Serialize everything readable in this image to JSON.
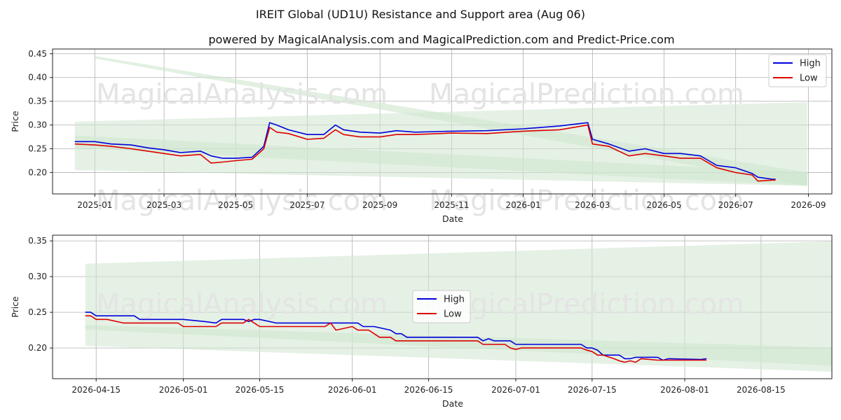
{
  "figure": {
    "title": "IREIT Global (UD1U) Resistance and Support area (Aug 06)",
    "subtitle": "powered by MagicalAnalysis.com and MagicalPrediction.com and Predict-Price.com",
    "watermarks": [
      "MagicalAnalysis.com",
      "MagicalPrediction.com"
    ]
  },
  "colors": {
    "high": "#0000dd",
    "low": "#dd0000",
    "band": "#cfe6cf",
    "grid": "#b0b0b0"
  },
  "chart_data": [
    {
      "type": "line",
      "xlabel": "Date",
      "ylabel": "Price",
      "xlim": [
        "2024-11-26",
        "2026-09-21"
      ],
      "ylim": [
        0.155,
        0.46
      ],
      "x_ticks": [
        "2025-01",
        "2025-03",
        "2025-05",
        "2025-07",
        "2025-09",
        "2025-11",
        "2026-01",
        "2026-03",
        "2026-05",
        "2026-07",
        "2026-09"
      ],
      "y_ticks": [
        "0.20",
        "0.25",
        "0.30",
        "0.35",
        "0.40",
        "0.45"
      ],
      "grid": true,
      "legend": "top-right",
      "series": [
        {
          "name": "High",
          "points": [
            [
              "2024-12-15",
              0.265
            ],
            [
              "2025-01-01",
              0.265
            ],
            [
              "2025-01-15",
              0.26
            ],
            [
              "2025-02-01",
              0.258
            ],
            [
              "2025-02-15",
              0.252
            ],
            [
              "2025-03-01",
              0.248
            ],
            [
              "2025-03-15",
              0.242
            ],
            [
              "2025-04-01",
              0.245
            ],
            [
              "2025-04-10",
              0.235
            ],
            [
              "2025-04-20",
              0.23
            ],
            [
              "2025-05-01",
              0.23
            ],
            [
              "2025-05-15",
              0.232
            ],
            [
              "2025-05-25",
              0.255
            ],
            [
              "2025-05-30",
              0.305
            ],
            [
              "2025-06-05",
              0.3
            ],
            [
              "2025-06-15",
              0.29
            ],
            [
              "2025-07-01",
              0.28
            ],
            [
              "2025-07-15",
              0.28
            ],
            [
              "2025-07-25",
              0.3
            ],
            [
              "2025-08-01",
              0.29
            ],
            [
              "2025-08-15",
              0.285
            ],
            [
              "2025-09-01",
              0.283
            ],
            [
              "2025-09-15",
              0.288
            ],
            [
              "2025-10-01",
              0.285
            ],
            [
              "2025-11-01",
              0.287
            ],
            [
              "2025-12-01",
              0.288
            ],
            [
              "2026-01-01",
              0.292
            ],
            [
              "2026-02-01",
              0.298
            ],
            [
              "2026-02-25",
              0.305
            ],
            [
              "2026-03-01",
              0.27
            ],
            [
              "2026-03-15",
              0.26
            ],
            [
              "2026-04-01",
              0.245
            ],
            [
              "2026-04-15",
              0.25
            ],
            [
              "2026-05-01",
              0.24
            ],
            [
              "2026-05-15",
              0.24
            ],
            [
              "2026-06-01",
              0.235
            ],
            [
              "2026-06-15",
              0.215
            ],
            [
              "2026-07-01",
              0.21
            ],
            [
              "2026-07-15",
              0.198
            ],
            [
              "2026-07-20",
              0.19
            ],
            [
              "2026-08-01",
              0.186
            ],
            [
              "2026-08-04",
              0.186
            ]
          ]
        },
        {
          "name": "Low",
          "points": [
            [
              "2024-12-15",
              0.26
            ],
            [
              "2025-01-01",
              0.258
            ],
            [
              "2025-01-15",
              0.255
            ],
            [
              "2025-02-01",
              0.25
            ],
            [
              "2025-02-15",
              0.245
            ],
            [
              "2025-03-01",
              0.24
            ],
            [
              "2025-03-15",
              0.235
            ],
            [
              "2025-04-01",
              0.238
            ],
            [
              "2025-04-10",
              0.22
            ],
            [
              "2025-04-20",
              0.222
            ],
            [
              "2025-05-01",
              0.225
            ],
            [
              "2025-05-15",
              0.228
            ],
            [
              "2025-05-25",
              0.25
            ],
            [
              "2025-05-30",
              0.295
            ],
            [
              "2025-06-05",
              0.285
            ],
            [
              "2025-06-15",
              0.282
            ],
            [
              "2025-07-01",
              0.27
            ],
            [
              "2025-07-15",
              0.272
            ],
            [
              "2025-07-25",
              0.29
            ],
            [
              "2025-08-01",
              0.28
            ],
            [
              "2025-08-15",
              0.275
            ],
            [
              "2025-09-01",
              0.275
            ],
            [
              "2025-09-15",
              0.28
            ],
            [
              "2025-10-01",
              0.28
            ],
            [
              "2025-11-01",
              0.283
            ],
            [
              "2025-12-01",
              0.282
            ],
            [
              "2026-01-01",
              0.287
            ],
            [
              "2026-02-01",
              0.29
            ],
            [
              "2026-02-25",
              0.3
            ],
            [
              "2026-03-01",
              0.26
            ],
            [
              "2026-03-15",
              0.255
            ],
            [
              "2026-04-01",
              0.235
            ],
            [
              "2026-04-15",
              0.24
            ],
            [
              "2026-05-01",
              0.235
            ],
            [
              "2026-05-15",
              0.23
            ],
            [
              "2026-06-01",
              0.23
            ],
            [
              "2026-06-15",
              0.21
            ],
            [
              "2026-07-01",
              0.2
            ],
            [
              "2026-07-15",
              0.195
            ],
            [
              "2026-07-20",
              0.182
            ],
            [
              "2026-08-01",
              0.184
            ],
            [
              "2026-08-04",
              0.184
            ]
          ]
        }
      ],
      "bands": [
        {
          "x": [
            "2024-12-15",
            "2026-08-31"
          ],
          "upper": [
            0.307,
            0.348
          ],
          "lower": [
            0.205,
            0.172
          ]
        },
        {
          "x": [
            "2024-12-15",
            "2026-08-31"
          ],
          "upper": [
            0.278,
            0.2
          ],
          "lower": [
            0.252,
            0.172
          ]
        },
        {
          "x": [
            "2025-01-01",
            "2026-08-31"
          ],
          "upper": [
            0.445,
            0.2
          ],
          "lower": [
            0.44,
            0.172
          ]
        }
      ]
    },
    {
      "type": "line",
      "xlabel": "Date",
      "ylabel": "Price",
      "xlim": [
        "2026-04-07",
        "2026-08-28"
      ],
      "ylim": [
        0.157,
        0.358
      ],
      "x_ticks": [
        "2026-04-15",
        "2026-05-01",
        "2026-05-15",
        "2026-06-01",
        "2026-06-15",
        "2026-07-01",
        "2026-07-15",
        "2026-08-01",
        "2026-08-15"
      ],
      "y_ticks": [
        "0.20",
        "0.25",
        "0.30",
        "0.35"
      ],
      "grid": true,
      "legend": "center",
      "series": [
        {
          "name": "High",
          "points": [
            [
              "2026-04-13",
              0.25
            ],
            [
              "2026-04-14",
              0.25
            ],
            [
              "2026-04-15",
              0.245
            ],
            [
              "2026-04-22",
              0.245
            ],
            [
              "2026-04-23",
              0.24
            ],
            [
              "2026-05-01",
              0.24
            ],
            [
              "2026-05-05",
              0.237
            ],
            [
              "2026-05-07",
              0.235
            ],
            [
              "2026-05-08",
              0.24
            ],
            [
              "2026-05-12",
              0.24
            ],
            [
              "2026-05-13",
              0.237
            ],
            [
              "2026-05-14",
              0.24
            ],
            [
              "2026-05-15",
              0.24
            ],
            [
              "2026-05-18",
              0.235
            ],
            [
              "2026-05-25",
              0.235
            ],
            [
              "2026-06-02",
              0.235
            ],
            [
              "2026-06-03",
              0.23
            ],
            [
              "2026-06-05",
              0.23
            ],
            [
              "2026-06-08",
              0.225
            ],
            [
              "2026-06-09",
              0.22
            ],
            [
              "2026-06-10",
              0.22
            ],
            [
              "2026-06-11",
              0.215
            ],
            [
              "2026-06-24",
              0.215
            ],
            [
              "2026-06-25",
              0.21
            ],
            [
              "2026-06-26",
              0.213
            ],
            [
              "2026-06-27",
              0.21
            ],
            [
              "2026-06-30",
              0.21
            ],
            [
              "2026-07-01",
              0.205
            ],
            [
              "2026-07-13",
              0.205
            ],
            [
              "2026-07-14",
              0.2
            ],
            [
              "2026-07-15",
              0.2
            ],
            [
              "2026-07-16",
              0.197
            ],
            [
              "2026-07-17",
              0.19
            ],
            [
              "2026-07-20",
              0.19
            ],
            [
              "2026-07-21",
              0.185
            ],
            [
              "2026-07-22",
              0.185
            ],
            [
              "2026-07-23",
              0.187
            ],
            [
              "2026-07-27",
              0.187
            ],
            [
              "2026-07-28",
              0.183
            ],
            [
              "2026-07-29",
              0.185
            ],
            [
              "2026-08-04",
              0.184
            ],
            [
              "2026-08-05",
              0.185
            ]
          ]
        },
        {
          "name": "Low",
          "points": [
            [
              "2026-04-13",
              0.245
            ],
            [
              "2026-04-14",
              0.245
            ],
            [
              "2026-04-15",
              0.24
            ],
            [
              "2026-04-17",
              0.24
            ],
            [
              "2026-04-20",
              0.235
            ],
            [
              "2026-04-30",
              0.235
            ],
            [
              "2026-05-01",
              0.23
            ],
            [
              "2026-05-07",
              0.23
            ],
            [
              "2026-05-08",
              0.235
            ],
            [
              "2026-05-12",
              0.235
            ],
            [
              "2026-05-13",
              0.24
            ],
            [
              "2026-05-14",
              0.235
            ],
            [
              "2026-05-15",
              0.23
            ],
            [
              "2026-05-27",
              0.23
            ],
            [
              "2026-05-28",
              0.235
            ],
            [
              "2026-05-29",
              0.225
            ],
            [
              "2026-06-01",
              0.23
            ],
            [
              "2026-06-02",
              0.225
            ],
            [
              "2026-06-04",
              0.225
            ],
            [
              "2026-06-06",
              0.215
            ],
            [
              "2026-06-08",
              0.215
            ],
            [
              "2026-06-09",
              0.21
            ],
            [
              "2026-06-24",
              0.21
            ],
            [
              "2026-06-25",
              0.205
            ],
            [
              "2026-06-29",
              0.205
            ],
            [
              "2026-06-30",
              0.2
            ],
            [
              "2026-07-01",
              0.198
            ],
            [
              "2026-07-02",
              0.2
            ],
            [
              "2026-07-13",
              0.2
            ],
            [
              "2026-07-14",
              0.197
            ],
            [
              "2026-07-15",
              0.195
            ],
            [
              "2026-07-16",
              0.19
            ],
            [
              "2026-07-17",
              0.19
            ],
            [
              "2026-07-19",
              0.185
            ],
            [
              "2026-07-20",
              0.182
            ],
            [
              "2026-07-21",
              0.18
            ],
            [
              "2026-07-22",
              0.182
            ],
            [
              "2026-07-23",
              0.18
            ],
            [
              "2026-07-24",
              0.185
            ],
            [
              "2026-07-27",
              0.183
            ],
            [
              "2026-08-05",
              0.183
            ]
          ]
        }
      ],
      "bands": [
        {
          "x": [
            "2026-04-13",
            "2026-08-31"
          ],
          "upper": [
            0.318,
            0.35
          ],
          "lower": [
            0.203,
            0.166
          ]
        },
        {
          "x": [
            "2026-04-13",
            "2026-08-31"
          ],
          "upper": [
            0.232,
            0.2
          ],
          "lower": [
            0.226,
            0.174
          ]
        }
      ]
    }
  ]
}
